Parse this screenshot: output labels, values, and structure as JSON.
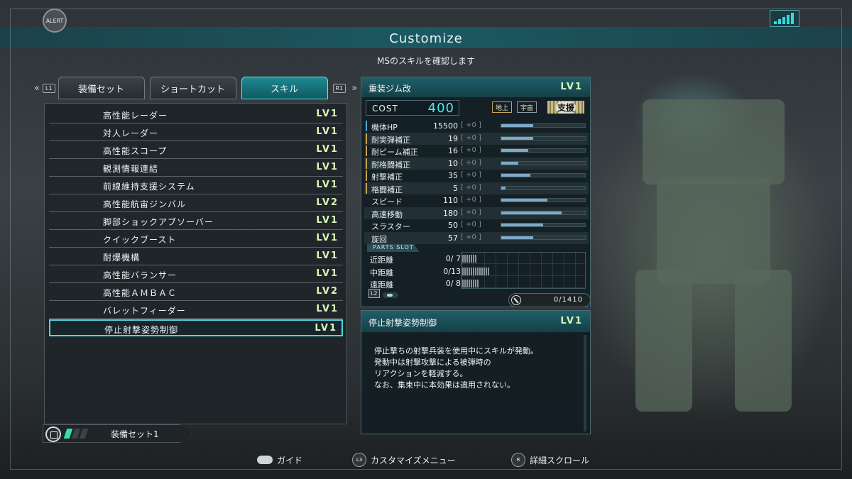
{
  "header": {
    "alert_label": "ALERT",
    "title": "Customize",
    "subtitle": "MSのスキルを確認します"
  },
  "tabs": {
    "left_shoulder": "L1",
    "right_shoulder": "R1",
    "items": [
      {
        "label": "装備セット",
        "active": false
      },
      {
        "label": "ショートカット",
        "active": false
      },
      {
        "label": "スキル",
        "active": true
      }
    ]
  },
  "skills": [
    {
      "name": "高性能レーダー",
      "level": "LV1"
    },
    {
      "name": "対人レーダー",
      "level": "LV1"
    },
    {
      "name": "高性能スコープ",
      "level": "LV1"
    },
    {
      "name": "観測情報連結",
      "level": "LV1"
    },
    {
      "name": "前線維持支援システム",
      "level": "LV1"
    },
    {
      "name": "高性能航宙ジンバル",
      "level": "LV2"
    },
    {
      "name": "脚部ショックアブソーバー",
      "level": "LV1"
    },
    {
      "name": "クイックブースト",
      "level": "LV1"
    },
    {
      "name": "耐爆機構",
      "level": "LV1"
    },
    {
      "name": "高性能バランサー",
      "level": "LV1"
    },
    {
      "name": "高性能ＡＭＢＡＣ",
      "level": "LV2"
    },
    {
      "name": "バレットフィーダー",
      "level": "LV1"
    },
    {
      "name": "停止射撃姿勢制御",
      "level": "LV1",
      "selected": true
    }
  ],
  "equipment_set": {
    "label": "装備セット1",
    "gauge_filled": 1,
    "gauge_total": 3
  },
  "ms": {
    "name": "重装ジム改",
    "level": "LV1",
    "cost_label": "COST",
    "cost": "400",
    "env_ground": "地上",
    "env_space": "宇宙",
    "role": "支援",
    "stats": [
      {
        "label": "機体HP",
        "value": "15500",
        "bonus": "[ +0 ]",
        "fill": 0.38,
        "mark": "#4aa8e0"
      },
      {
        "label": "耐実弾補正",
        "value": "19",
        "bonus": "[ +0 ]",
        "fill": 0.38,
        "mark": "#c8a050"
      },
      {
        "label": "耐ビーム補正",
        "value": "16",
        "bonus": "[ +0 ]",
        "fill": 0.32,
        "mark": "#c8a050"
      },
      {
        "label": "耐格闘補正",
        "value": "10",
        "bonus": "[ +0 ]",
        "fill": 0.2,
        "mark": "#c8a050"
      },
      {
        "label": "射撃補正",
        "value": "35",
        "bonus": "[ +0 ]",
        "fill": 0.35,
        "mark": "#c8a050"
      },
      {
        "label": "格闘補正",
        "value": "5",
        "bonus": "[ +0 ]",
        "fill": 0.05,
        "mark": "#c8a050"
      },
      {
        "label": "スピード",
        "value": "110",
        "bonus": "[ +0 ]",
        "fill": 0.55,
        "mark": ""
      },
      {
        "label": "高速移動",
        "value": "180",
        "bonus": "[ +0 ]",
        "fill": 0.72,
        "mark": ""
      },
      {
        "label": "スラスター",
        "value": "50",
        "bonus": "[ +0 ]",
        "fill": 0.5,
        "mark": ""
      },
      {
        "label": "旋回",
        "value": "57",
        "bonus": "[ +0 ]",
        "fill": 0.38,
        "mark": ""
      }
    ],
    "parts_slot_title": "PARTS SLOT",
    "slots": [
      {
        "label": "近距離",
        "value": "0/ 7",
        "cells": 7
      },
      {
        "label": "中距離",
        "value": "0/13",
        "cells": 13
      },
      {
        "label": "遠距離",
        "value": "0/ 8",
        "cells": 8
      }
    ],
    "l2_label": "L2",
    "capacity": "0/1410"
  },
  "detail": {
    "name": "停止射撃姿勢制御",
    "level": "LV1",
    "lines": [
      "停止撃ちの射撃兵装を使用中にスキルが発動。",
      "発動中は射撃攻撃による被弾時の",
      "リアクションを軽減する。",
      "なお、集束中に本効果は適用されない。"
    ]
  },
  "footer": {
    "guide_label": "ガイド",
    "l3_label": "L3",
    "menu_label": "カスタマイズメニュー",
    "r_label": "R",
    "scroll_label": "詳細スクロール"
  },
  "colors": {
    "accent": "#54d4df",
    "level_text": "#d8f8b8",
    "cost": "#4de8f0",
    "panel_header": "#1f5f69"
  }
}
